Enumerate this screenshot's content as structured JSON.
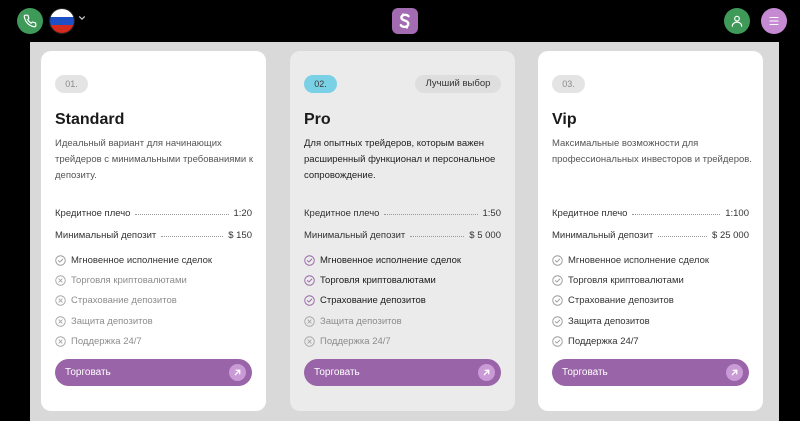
{
  "header": {
    "phone_icon": "phone-icon",
    "flag_icon": "russia-flag-icon",
    "logo_letter": "S",
    "user_icon": "user-icon",
    "menu_icon": "menu-icon",
    "colors": {
      "green": "#3f9a5a",
      "purple": "#a36bb1",
      "menu": "#c68ad3"
    }
  },
  "plans": [
    {
      "num": "01.",
      "title": "Standard",
      "description": "Идеальный вариант для начинающих трейдеров с минимальными требованиями к депозиту.",
      "leverage_label": "Кредитное плечо",
      "leverage": "1:20",
      "deposit_label": "Минимальный депозит",
      "deposit": "$ 150",
      "features": [
        {
          "label": "Мгновенное исполнение сделок",
          "enabled": true
        },
        {
          "label": "Торговля криптовалютами",
          "enabled": false
        },
        {
          "label": "Страхование депозитов",
          "enabled": false
        },
        {
          "label": "Защита депозитов",
          "enabled": false
        },
        {
          "label": "Поддержка 24/7",
          "enabled": false
        }
      ],
      "button": "Торговать"
    },
    {
      "num": "02.",
      "best": "Лучший выбор",
      "title": "Pro",
      "description": "Для опытных трейдеров, которым важен расширенный функционал и персональное сопровождение.",
      "leverage_label": "Кредитное плечо",
      "leverage": "1:50",
      "deposit_label": "Минимальный депозит",
      "deposit": "$ 5 000",
      "features": [
        {
          "label": "Мгновенное исполнение сделок",
          "enabled": true
        },
        {
          "label": "Торговля криптовалютами",
          "enabled": true
        },
        {
          "label": "Страхование депозитов",
          "enabled": true
        },
        {
          "label": "Защита депозитов",
          "enabled": false
        },
        {
          "label": "Поддержка 24/7",
          "enabled": false
        }
      ],
      "button": "Торговать"
    },
    {
      "num": "03.",
      "title": "Vip",
      "description": "Максимальные возможности для профессиональных инвесторов и трейдеров.",
      "leverage_label": "Кредитное плечо",
      "leverage": "1:100",
      "deposit_label": "Минимальный депозит",
      "deposit": "$ 25 000",
      "features": [
        {
          "label": "Мгновенное исполнение сделок",
          "enabled": true
        },
        {
          "label": "Торговля криптовалютами",
          "enabled": true
        },
        {
          "label": "Страхование депозитов",
          "enabled": true
        },
        {
          "label": "Защита депозитов",
          "enabled": true
        },
        {
          "label": "Поддержка 24/7",
          "enabled": true
        }
      ],
      "button": "Торговать"
    }
  ]
}
